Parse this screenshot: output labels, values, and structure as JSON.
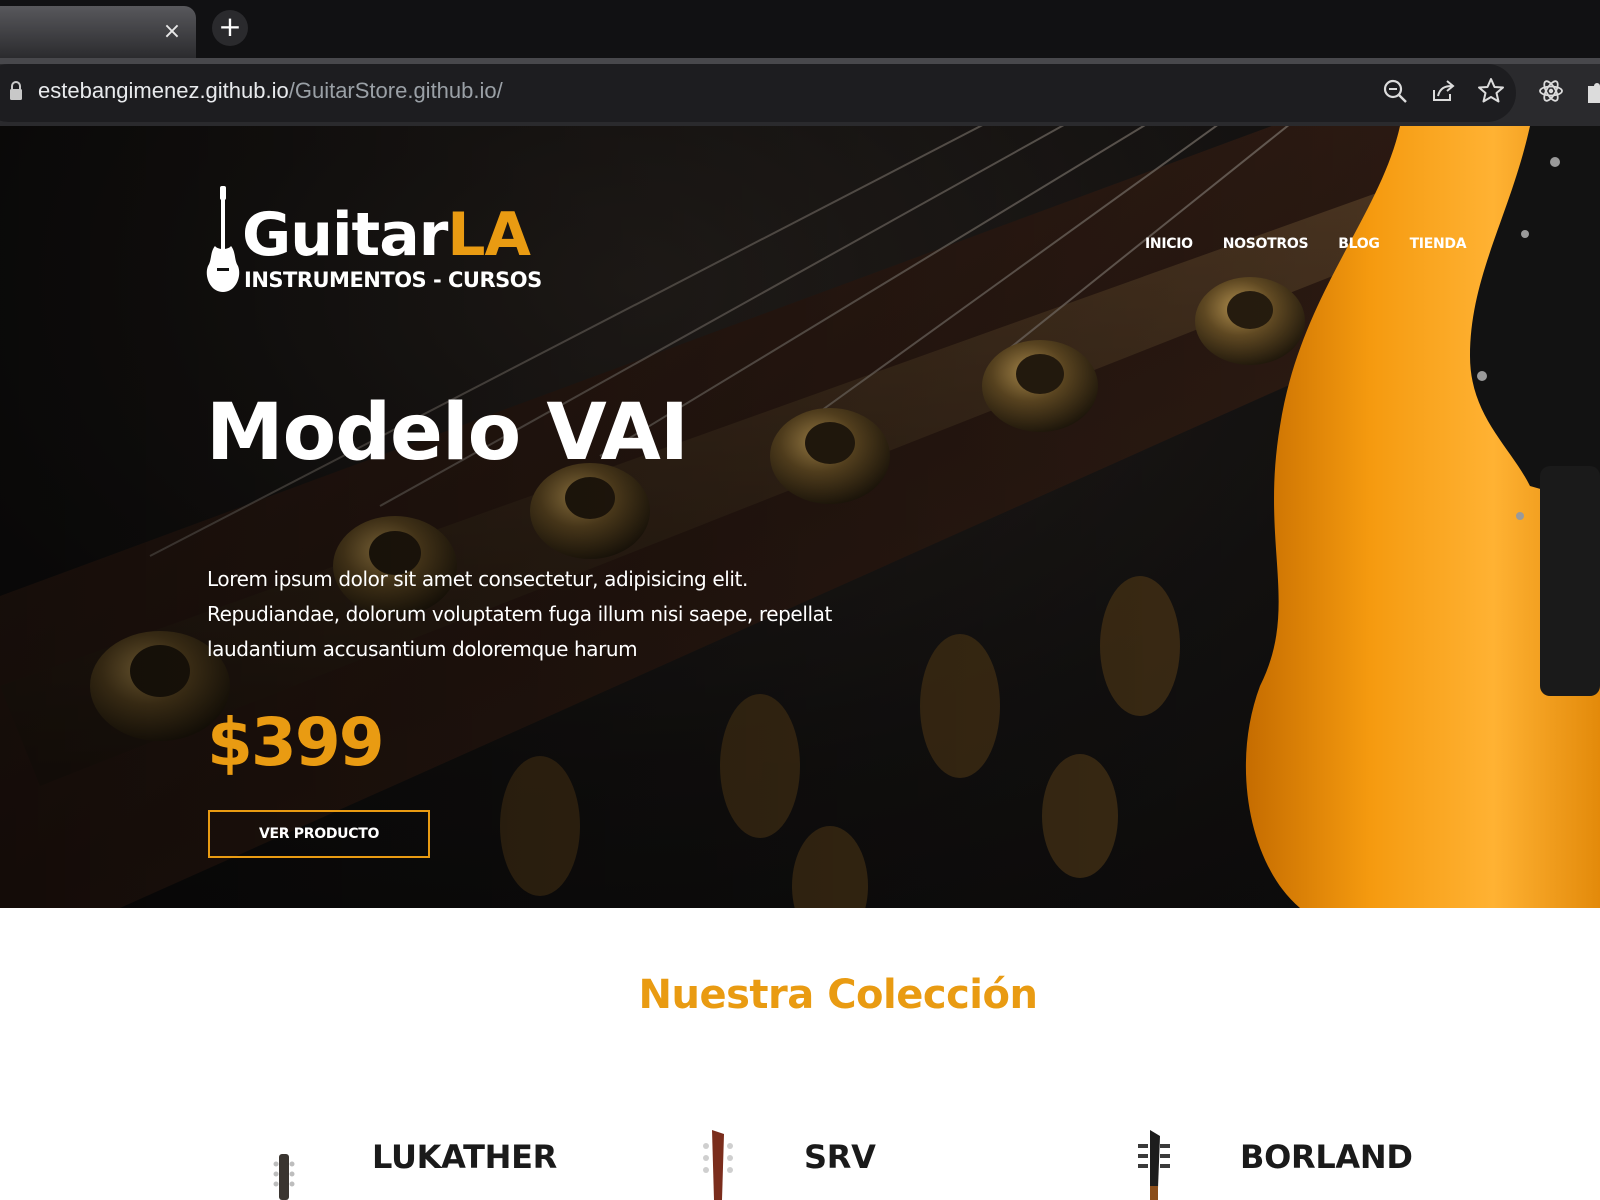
{
  "browser": {
    "tab_close_glyph": "×",
    "new_tab_glyph": "+",
    "url_host": "estebangimenez.github.io",
    "url_path": "/GuitarStore.github.io/"
  },
  "site": {
    "logo": {
      "brand_main": "Guitar",
      "brand_accent": "LA",
      "tagline": "INSTRUMENTOS - CURSOS"
    },
    "nav": [
      "INICIO",
      "NOSOTROS",
      "BLOG",
      "TIENDA"
    ],
    "hero": {
      "title": "Modelo VAI",
      "text": "Lorem ipsum dolor sit amet consectetur, adipisicing elit. Repudiandae, dolorum voluptatem fuga illum nisi saepe, repellat laudantium accusantium doloremque harum",
      "price": "$399",
      "button": "VER PRODUCTO"
    },
    "collection": {
      "title": "Nuestra Colección",
      "products": [
        "LUKATHER",
        "SRV",
        "BORLAND"
      ]
    }
  },
  "colors": {
    "accent": "#e99b12",
    "guitar_body": "#f59a0f",
    "chrome_bg": "#2a2a2d"
  },
  "icons": [
    "lock-icon",
    "zoom-icon",
    "share-icon",
    "star-icon",
    "react-extension-icon",
    "puzzle-extension-icon",
    "guitar-icon"
  ]
}
